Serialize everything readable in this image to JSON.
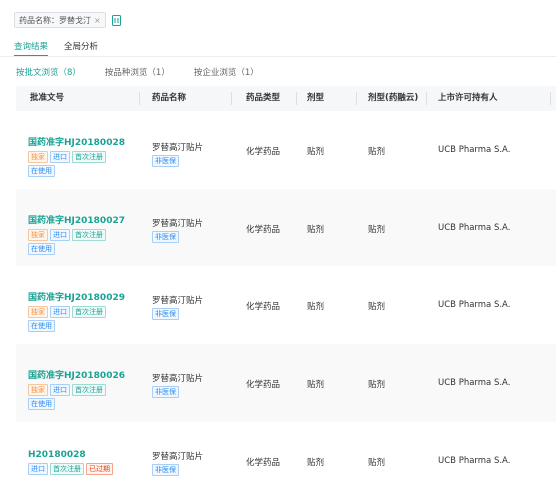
{
  "filter": {
    "chip_label": "药品名称：罗替戈汀",
    "chip_close": "×"
  },
  "tabs": [
    {
      "label": "查询结果",
      "active": true
    },
    {
      "label": "全局分析",
      "active": false
    }
  ],
  "subtabs": [
    {
      "label": "按批文浏览（8）",
      "active": true
    },
    {
      "label": "按品种浏览（1）",
      "active": false
    },
    {
      "label": "按企业浏览（1）",
      "active": false
    }
  ],
  "columns": [
    "批准文号",
    "药品名称",
    "药品类型",
    "剂型",
    "剂型(药融云)",
    "上市许可持有人"
  ],
  "rows": [
    {
      "approval": "国药准字HJ20180028",
      "tags": [
        {
          "text": "独家",
          "color": "orange"
        },
        {
          "text": "进口",
          "color": "blue"
        },
        {
          "text": "首次注册",
          "color": "green"
        },
        {
          "text": "在使用",
          "color": "blue"
        }
      ],
      "drug": "罗替高汀贴片",
      "insurance": "非医保",
      "type": "化学药品",
      "form": "贴剂",
      "form2": "贴剂",
      "holder": "UCB Pharma S.A."
    },
    {
      "approval": "国药准字HJ20180027",
      "tags": [
        {
          "text": "独家",
          "color": "orange"
        },
        {
          "text": "进口",
          "color": "blue"
        },
        {
          "text": "首次注册",
          "color": "green"
        },
        {
          "text": "在使用",
          "color": "blue"
        }
      ],
      "drug": "罗替高汀贴片",
      "insurance": "非医保",
      "type": "化学药品",
      "form": "贴剂",
      "form2": "贴剂",
      "holder": "UCB Pharma S.A."
    },
    {
      "approval": "国药准字HJ20180029",
      "tags": [
        {
          "text": "独家",
          "color": "orange"
        },
        {
          "text": "进口",
          "color": "blue"
        },
        {
          "text": "首次注册",
          "color": "green"
        },
        {
          "text": "在使用",
          "color": "blue"
        }
      ],
      "drug": "罗替高汀贴片",
      "insurance": "非医保",
      "type": "化学药品",
      "form": "贴剂",
      "form2": "贴剂",
      "holder": "UCB Pharma S.A."
    },
    {
      "approval": "国药准字HJ20180026",
      "tags": [
        {
          "text": "独家",
          "color": "orange"
        },
        {
          "text": "进口",
          "color": "blue"
        },
        {
          "text": "首次注册",
          "color": "green"
        },
        {
          "text": "在使用",
          "color": "blue"
        }
      ],
      "drug": "罗替高汀贴片",
      "insurance": "非医保",
      "type": "化学药品",
      "form": "贴剂",
      "form2": "贴剂",
      "holder": "UCB Pharma S.A."
    },
    {
      "approval": "H20180028",
      "tags": [
        {
          "text": "进口",
          "color": "blue"
        },
        {
          "text": "首次注册",
          "color": "green"
        },
        {
          "text": "已过期",
          "color": "red"
        }
      ],
      "drug": "罗替高汀贴片",
      "insurance": "非医保",
      "type": "化学药品",
      "form": "贴剂",
      "form2": "贴剂",
      "holder": "UCB Pharma S.A."
    }
  ],
  "colors": {
    "accent": "#1aa394",
    "tag_orange": "#f5923e",
    "tag_blue": "#2d8cf0",
    "tag_red": "#ed4014"
  }
}
